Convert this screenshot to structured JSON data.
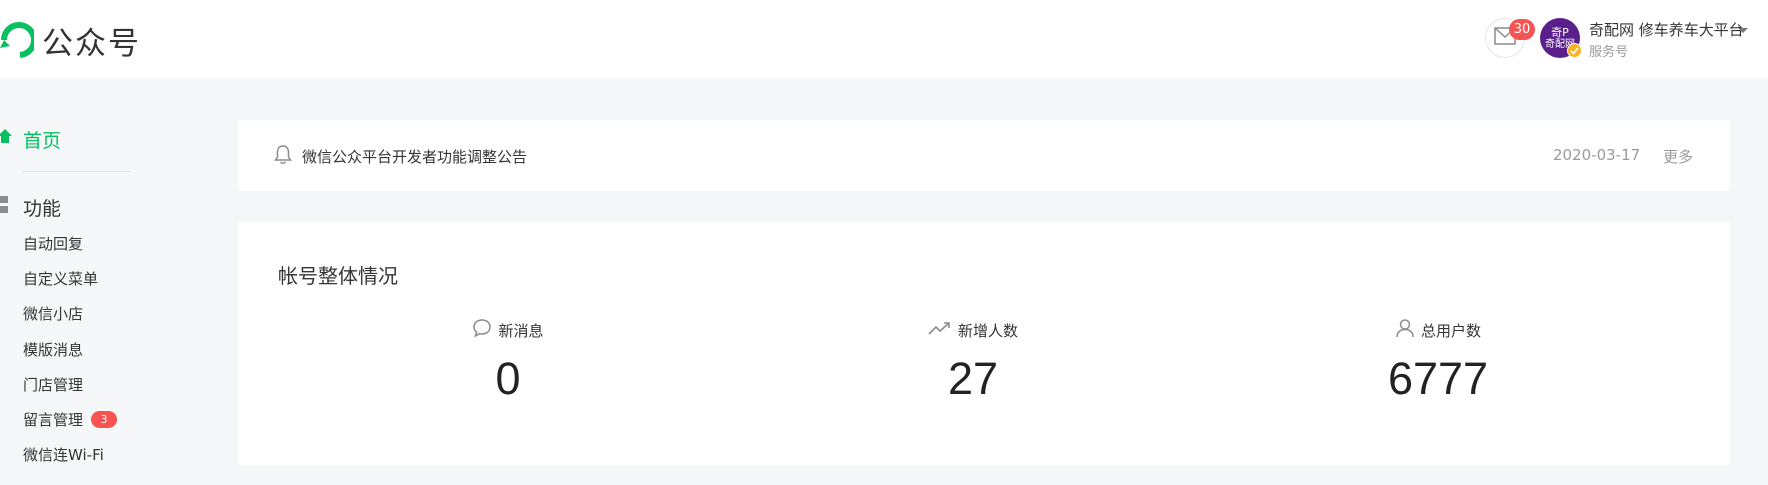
{
  "header": {
    "app_name": "公众号",
    "logo_icon": "wechat-mp-logo-icon",
    "brand_color": "#07c160",
    "mail_icon": "mail-icon",
    "unread_count": "30",
    "avatar_text_top": "奇P",
    "avatar_text_bottom": "奇配网",
    "account_name": "奇配网 修车养车大平台",
    "account_type": "服务号"
  },
  "sidebar": {
    "home_label": "首页",
    "section_label": "功能",
    "items": [
      {
        "label": "自动回复"
      },
      {
        "label": "自定义菜单"
      },
      {
        "label": "微信小店"
      },
      {
        "label": "模版消息"
      },
      {
        "label": "门店管理"
      },
      {
        "label": "留言管理",
        "badge": "3"
      },
      {
        "label": "微信连Wi-Fi"
      }
    ]
  },
  "notice": {
    "icon": "bell-icon",
    "text": "微信公众平台开发者功能调整公告",
    "date": "2020-03-17",
    "more_label": "更多"
  },
  "stats": {
    "title": "帐号整体情况",
    "items": [
      {
        "icon": "message-bubble-icon",
        "label": "新消息",
        "value": "0"
      },
      {
        "icon": "trend-up-icon",
        "label": "新增人数",
        "value": "27"
      },
      {
        "icon": "user-icon",
        "label": "总用户数",
        "value": "6777"
      }
    ]
  }
}
